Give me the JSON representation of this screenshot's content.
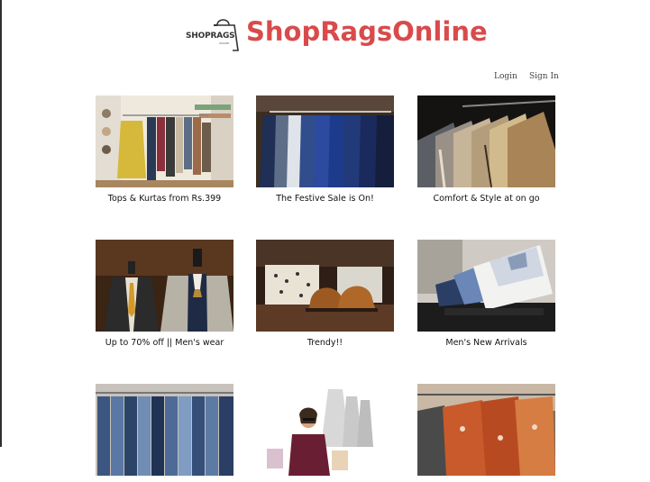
{
  "brand": {
    "logo_text": "SHOPRAGS",
    "logo_sub": "ONLINE",
    "name": "ShopRagsOnline",
    "color": "#d94b4b"
  },
  "nav": {
    "login": "Login",
    "signin": "Sign In"
  },
  "products": [
    {
      "caption": "Tops & Kurtas from Rs.399"
    },
    {
      "caption": "The Festive Sale is On!"
    },
    {
      "caption": "Comfort & Style at on go"
    },
    {
      "caption": "Up to 70% off || Men's wear"
    },
    {
      "caption": "Trendy!!"
    },
    {
      "caption": "Men's New Arrivals"
    },
    {
      "caption": ""
    },
    {
      "caption": ""
    },
    {
      "caption": ""
    }
  ]
}
